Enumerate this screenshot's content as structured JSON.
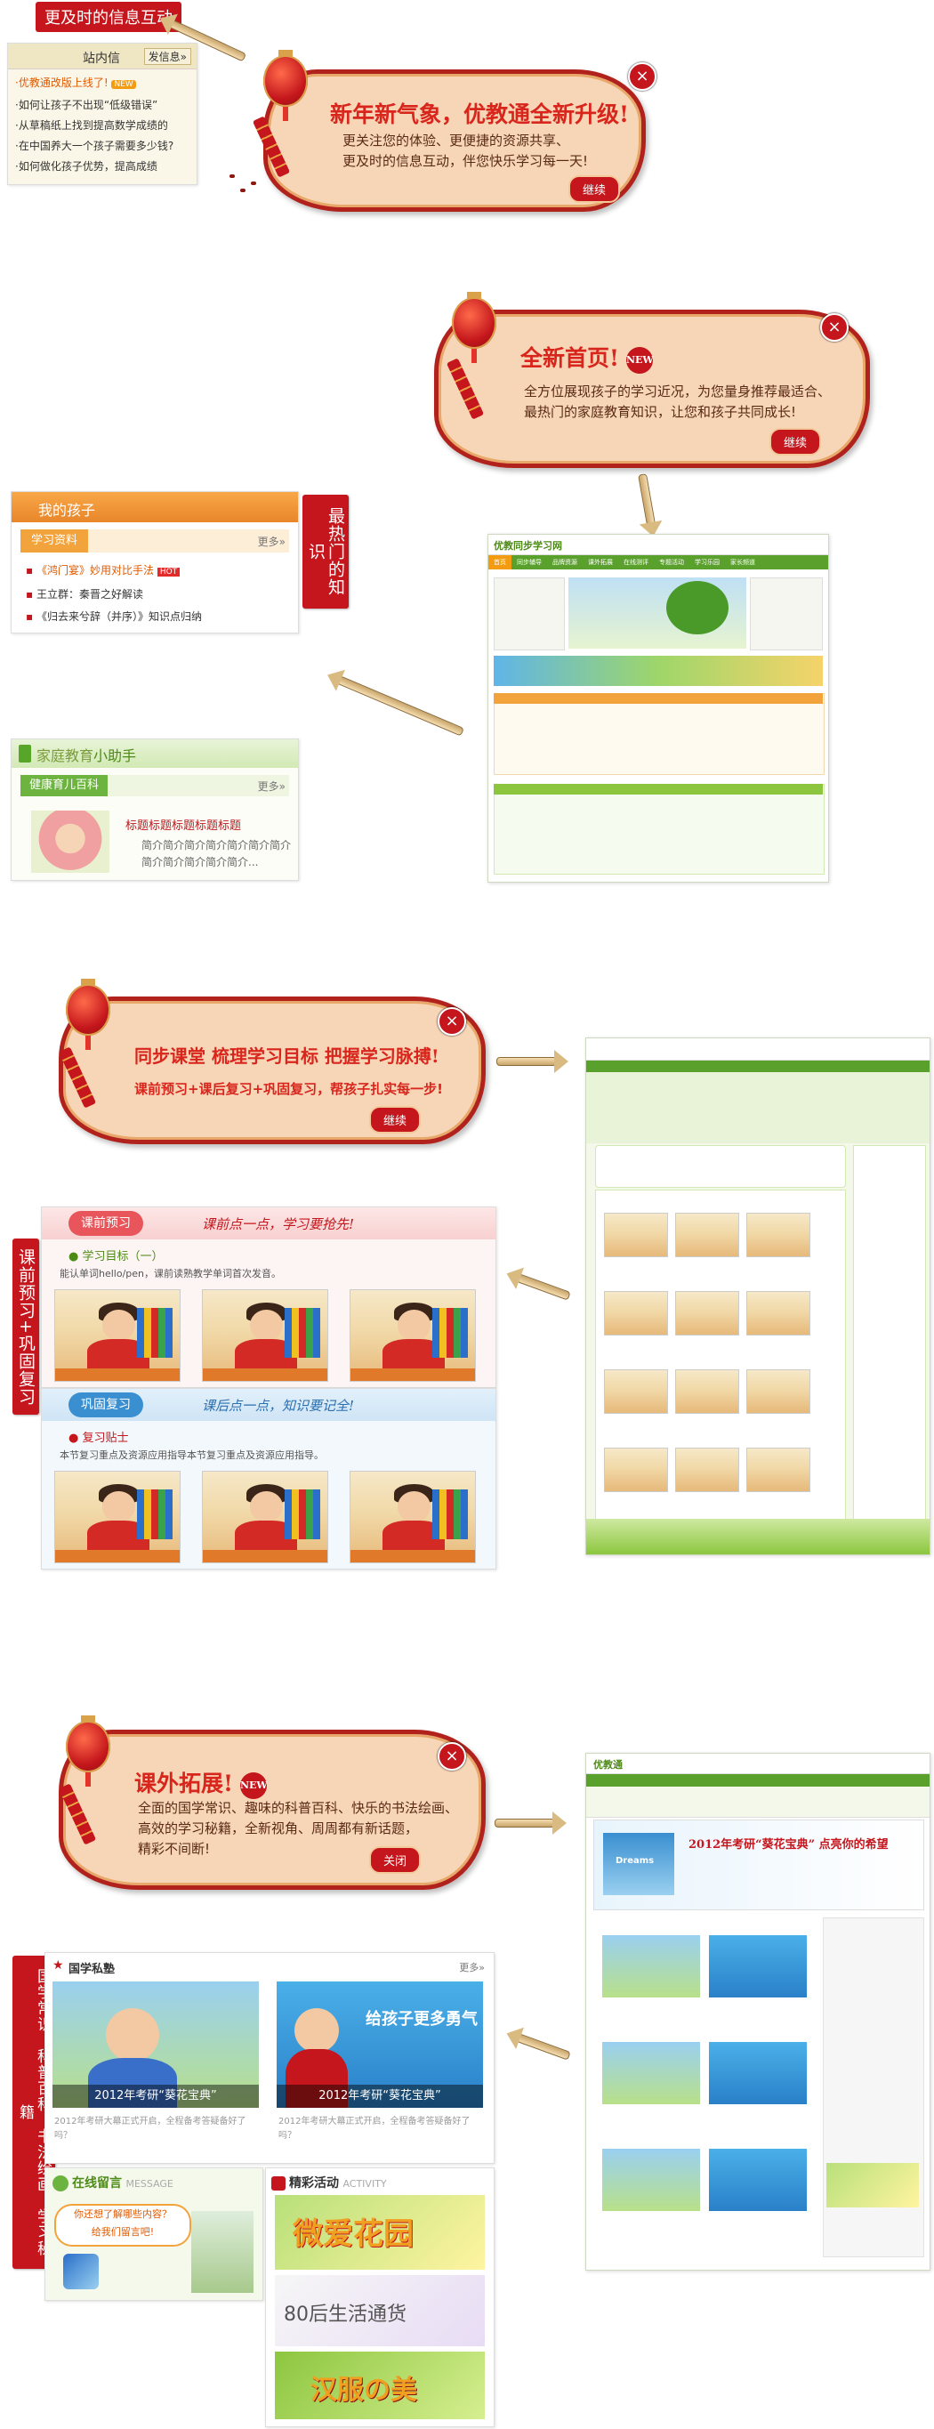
{
  "section1": {
    "label": "更及时的信息互动",
    "mailbox": {
      "title": "站内信",
      "send_button": "发信息»",
      "items": [
        "·优教通改版上线了!",
        "·如何让孩子不出现“低级错误”",
        "·从草稿纸上找到提高数学成绩的",
        "·在中国养大一个孩子需要多少钱?",
        "·如何做化孩子优势，提高成绩"
      ],
      "new_badge": "NEW"
    },
    "bubble": {
      "title": "新年新气象，优教通全新升级!",
      "lines": [
        "更关注您的体验、更便捷的资源共享、",
        "更及时的信息互动，伴您快乐学习每一天!"
      ],
      "button": "继续",
      "close": "×"
    }
  },
  "section2": {
    "label": "最热门的知识",
    "bubble": {
      "title": "全新首页!",
      "new_badge": "NEW",
      "lines": [
        "全方位展现孩子的学习近况，为您量身推荐最适合、",
        "最热门的家庭教育知识，让您和孩子共同成长!"
      ],
      "button": "继续",
      "close": "×"
    },
    "my_child": {
      "title": "我的孩子",
      "tab": "学习资料",
      "more": "更多»",
      "items": [
        "《鸿门宴》妙用对比手法",
        "王立群：秦晋之好解读",
        "《归去来兮辞（并序）》知识点归纳"
      ],
      "hot_badge": "HOT"
    },
    "helper": {
      "title_a": "家庭教育",
      "title_b": "小助手",
      "tab": "健康育儿百科",
      "more": "更多»",
      "headline": "标题标题标题标题标题",
      "summary": "简介简介简介简介简介简介简介简介简介简介简介简介..."
    },
    "homepage_shot": {
      "brand": "优教同步学习网",
      "nav": [
        "首页",
        "同步辅导",
        "品牌资源",
        "课外拓展",
        "在线测评",
        "专题活动",
        "学习乐园",
        "家长频道"
      ]
    }
  },
  "section3": {
    "label": "课前预习+巩固复习",
    "bubble": {
      "title": "同步课堂 梳理学习目标 把握学习脉搏!",
      "subtitle": "课前预习+课后复习+巩固复习，帮孩子扎实每一步!",
      "button": "继续",
      "close": "×"
    },
    "preview": {
      "tab": "课前预习",
      "slogan": "课前点一点，学习要抢先!",
      "heading": "学习目标（一）",
      "desc": "能认单词hello/pen，课前读熟教学单词首次发音。"
    },
    "review": {
      "tab": "巩固复习",
      "slogan": "课后点一点，知识要记全!",
      "heading": "复习贴士",
      "desc": "本节复习重点及资源应用指导本节复习重点及资源应用指导。"
    }
  },
  "section4": {
    "label": "国学常识、科普百科、书法绘画、学习秘籍",
    "bubble": {
      "title": "课外拓展!",
      "new_badge": "NEW",
      "lines": [
        "全面的国学常识、趣味的科普百科、快乐的书法绘画、",
        "高效的学习秘籍，全新视角、周周都有新话题，",
        "精彩不间断!"
      ],
      "button": "关闭",
      "close": "×"
    },
    "guoxue": {
      "title": "国学私塾",
      "more": "更多»",
      "caption_left": "2012年考研“葵花宝典”",
      "caption_right": "2012年考研“葵花宝典”",
      "banner_text": "给孩子更多勇气",
      "summary": "2012年考研大幕正式开启，全程备考答疑备好了吗？"
    },
    "message": {
      "title": "在线留言",
      "title_en": "MESSAGE",
      "bubble_text": "你还想了解哪些内容？",
      "bubble_text2": "给我们留言吧!"
    },
    "activity": {
      "title": "精彩活动",
      "title_en": "ACTIVITY",
      "banners": [
        "微爱花园",
        "80后生活通货",
        "汉服の美"
      ]
    },
    "extension_shot": {
      "brand": "优教通",
      "banner_title": "2012年考研“葵花宝典” 点亮你的希望",
      "dreams_label": "Dreams"
    }
  }
}
